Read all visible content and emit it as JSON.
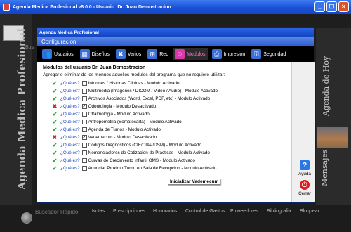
{
  "window": {
    "title": "Agenda Medica Profesional v8.0.0 - Usuario: Dr. Juan Demostracion",
    "min_label": "_",
    "max_label": "❐",
    "close_label": "✕"
  },
  "left_bar": {
    "brand": "Agenda Medica Profesional",
    "bs_label": "Bus"
  },
  "dialog": {
    "title": "Agenda Medica Profesional",
    "header": "Configuracion",
    "toolbar": [
      {
        "label": "Usuarios",
        "icon": "users-icon",
        "color": "#3a6fd8",
        "glyph": "👥"
      },
      {
        "label": "Diseños",
        "icon": "design-icon",
        "color": "#3a6fd8",
        "glyph": "▦"
      },
      {
        "label": "Varios",
        "icon": "tools-icon",
        "color": "#3a6fd8",
        "glyph": "✖"
      },
      {
        "label": "Red",
        "icon": "network-icon",
        "color": "#3a6fd8",
        "glyph": "⊞"
      },
      {
        "label": "Modulos",
        "icon": "modules-icon",
        "color": "#d63aa8",
        "glyph": "⚙"
      },
      {
        "label": "Impresion",
        "icon": "printer-icon",
        "color": "#3a6fd8",
        "glyph": "⎙"
      },
      {
        "label": "Seguridad",
        "icon": "key-icon",
        "color": "#3a6fd8",
        "glyph": "⚿"
      }
    ],
    "active_tab": "Modulos",
    "content_title": "Modulos del usuario Dr. Juan Demostracion",
    "content_subtitle": "Agregar o eliminar de los menues aquellos modulos del programa que no requiere utilizar:",
    "question_label": "¿Qué es?",
    "modules": [
      {
        "label": "Informes / Historias Clinicas - Modulo Activado",
        "active": true
      },
      {
        "label": "Multimedia (Imagenes / DICOM / Video / Audio) - Modulo Activado",
        "active": true
      },
      {
        "label": "Archivos Asociados (Word, Excel, PDF, etc) - Modulo Activado",
        "active": true
      },
      {
        "label": "Odontologia - Modulo Desactivado",
        "active": false
      },
      {
        "label": "Oftalmologia - Modulo Activado",
        "active": true
      },
      {
        "label": "Antropometria (Somatocarta) - Modulo Activado",
        "active": true
      },
      {
        "label": "Agenda de Turnos - Modulo Activado",
        "active": true
      },
      {
        "label": "Vademecum - Modulo Desactivado",
        "active": false
      },
      {
        "label": "Codigos Diagnosticos (CIE/CIAP/DSM) - Modulo Activado",
        "active": true
      },
      {
        "label": "Nomenclaclores de Cotizacion de Practicas - Modulo Activado",
        "active": true
      },
      {
        "label": "Curvas de Crecimiento Infantil OMS - Modulo Activado",
        "active": true
      },
      {
        "label": "Anunciar Proximo Turno en Sala de Recepcion - Modulo Activado",
        "active": true
      }
    ],
    "tooltip": "Inicializar Vademecum",
    "help_label": "Ayuda",
    "close_label": "Cerrar"
  },
  "right_panel": {
    "agenda_label": "Agenda de Hoy",
    "messages_label": "Mensajes"
  },
  "bottom_nav": {
    "search_label": "Buscador Rapido",
    "items": [
      "Notas",
      "Prescripciones",
      "Honorarios",
      "Control de Gastos",
      "Proveedores",
      "Bibliografia",
      "Bloquear"
    ]
  }
}
